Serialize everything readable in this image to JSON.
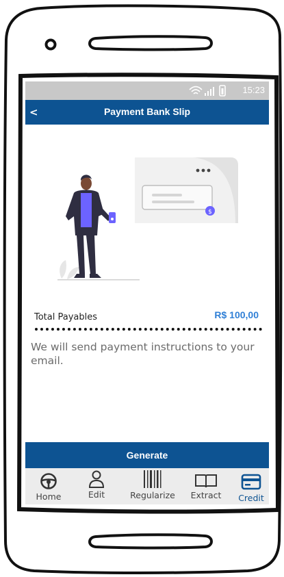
{
  "status_bar": {
    "time": "15:23"
  },
  "header": {
    "back_label": "<",
    "title": "Payment Bank Slip"
  },
  "totals": {
    "label": "Total Payables",
    "value": "R$ 100,00"
  },
  "instructions": "We will send payment instructions to your email.",
  "actions": {
    "generate_label": "Generate"
  },
  "bottom_nav": {
    "items": [
      {
        "label": "Home",
        "icon": "steering-wheel-icon"
      },
      {
        "label": "Edit",
        "icon": "user-icon"
      },
      {
        "label": "Regularize",
        "icon": "barcode-icon"
      },
      {
        "label": "Extract",
        "icon": "book-icon"
      },
      {
        "label": "Credit",
        "icon": "credit-card-icon",
        "active": true
      }
    ]
  },
  "colors": {
    "primary": "#0d5392",
    "accent": "#2f7fd6",
    "status_bar": "#c8c8c8",
    "nav_background": "#ececec"
  }
}
